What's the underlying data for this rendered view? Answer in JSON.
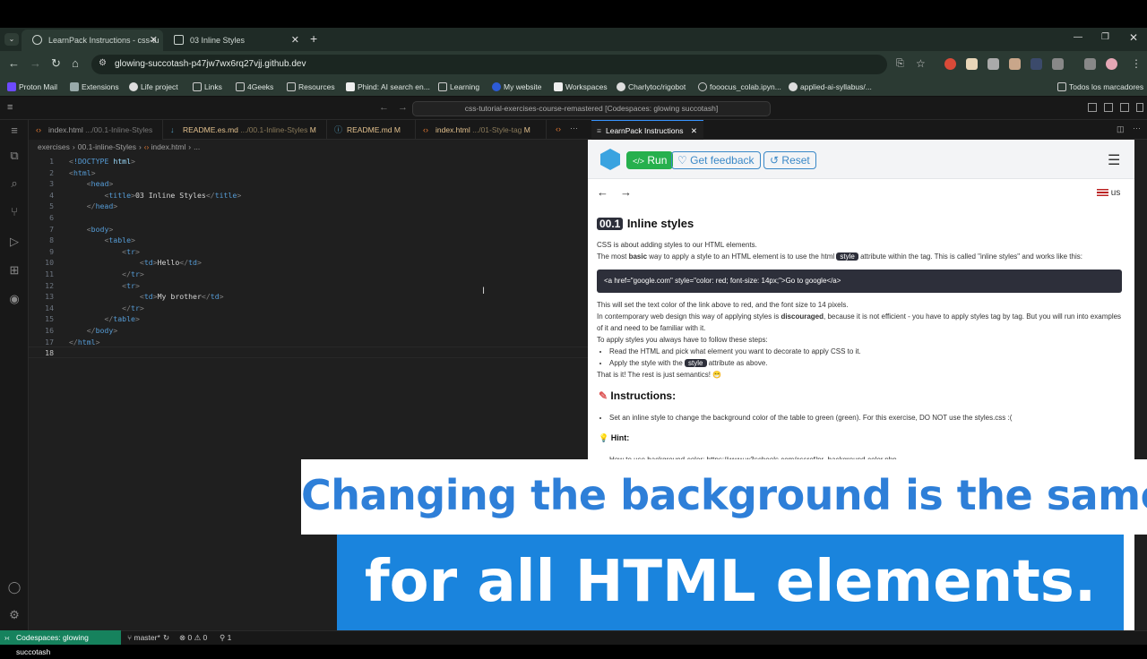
{
  "browser": {
    "tabs": [
      {
        "label": "LearnPack Instructions - css-tu"
      },
      {
        "label": "03 Inline Styles"
      }
    ],
    "new_tab": "+",
    "url": "glowing-succotash-p47jw7wx6rq27vjj.github.dev",
    "bookmarks": [
      "Proton Mail",
      "Extensions",
      "Life project",
      "Links",
      "4Geeks",
      "Resources",
      "Phind: AI search en...",
      "Learning",
      "My website",
      "Workspaces",
      "Charlytoc/rigobot",
      "fooocus_colab.ipyn...",
      "applied-ai-syllabus/...",
      "Todos los marcadores"
    ]
  },
  "vscode": {
    "command_center": "css-tutorial-exercises-course-remastered [Codespaces: glowing succotash]",
    "editor_tabs": [
      {
        "name": "index.html",
        "path": ".../00.1-Inline-Styles",
        "mod": ""
      },
      {
        "name": "README.es.md",
        "path": ".../00.1-Inline-Styles",
        "mod": "M"
      },
      {
        "name": "README.md",
        "path": "",
        "mod": "M"
      },
      {
        "name": "index.html",
        "path": ".../01-Style-tag",
        "mod": "M"
      }
    ],
    "more_tabs": "···",
    "breadcrumb": [
      "exercises",
      "00.1-inline-Styles",
      "index.html",
      "..."
    ],
    "code_lines": [
      "<!DOCTYPE html>",
      "<html>",
      "    <head>",
      "        <title>03 Inline Styles</title>",
      "    </head>",
      "",
      "    <body>",
      "        <table>",
      "            <tr>",
      "                <td>Hello</td>",
      "            </tr>",
      "            <tr>",
      "                <td>My brother</td>",
      "            </tr>",
      "        </table>",
      "    </body>",
      "</html>",
      ""
    ],
    "status": {
      "remote": "Codespaces: glowing succotash",
      "branch": "master*",
      "problems": "⊗ 0 ⚠ 0",
      "ports": "1"
    }
  },
  "learnpack": {
    "panel_tab": "LearnPack Instructions",
    "run_label": "Run",
    "feedback_label": "Get feedback",
    "reset_label": "Reset",
    "lang": "us",
    "badge": "00.1",
    "title": "Inline styles",
    "p1": "CSS is about adding styles to our HTML elements.",
    "p2a": "The most ",
    "p2b": "basic",
    "p2c": " way to apply a style to an HTML element is to use the html ",
    "p2d": "style",
    "p2e": " attribute within the tag. This is called \"inline styles\" and works like this:",
    "code": "<a href=\"google.com\" style=\"color: red; font-size: 14px;\">Go to google</a>",
    "p3": "This will set the text color of the link above to red, and the font size to 14 pixels.",
    "p4a": "In contemporary web design this way of applying styles is ",
    "p4b": "discouraged",
    "p4c": ", because it is not efficient - you have to apply styles tag by tag. But you will run into examples of it and need to be familiar with it.",
    "p5": "To apply styles you always have to follow these steps:",
    "steps": [
      "Read the HTML and pick what element you want to decorate to apply CSS to it.",
      "Apply the style with the ",
      "style",
      " attribute as above."
    ],
    "p6": "That is it! The rest is just semantics! 😁",
    "instr_title": "Instructions:",
    "instr_item": "Set an inline style to change the background color of the table to green (green). For this exercise, DO NOT use the styles.css :(",
    "hint_title": "Hint:",
    "hint_item": "How to use background-color: https://www.w3schools.com/cssref/pr_background-color.php"
  },
  "captions": {
    "line1": "Changing the background is the same",
    "line2": "for all HTML elements."
  }
}
